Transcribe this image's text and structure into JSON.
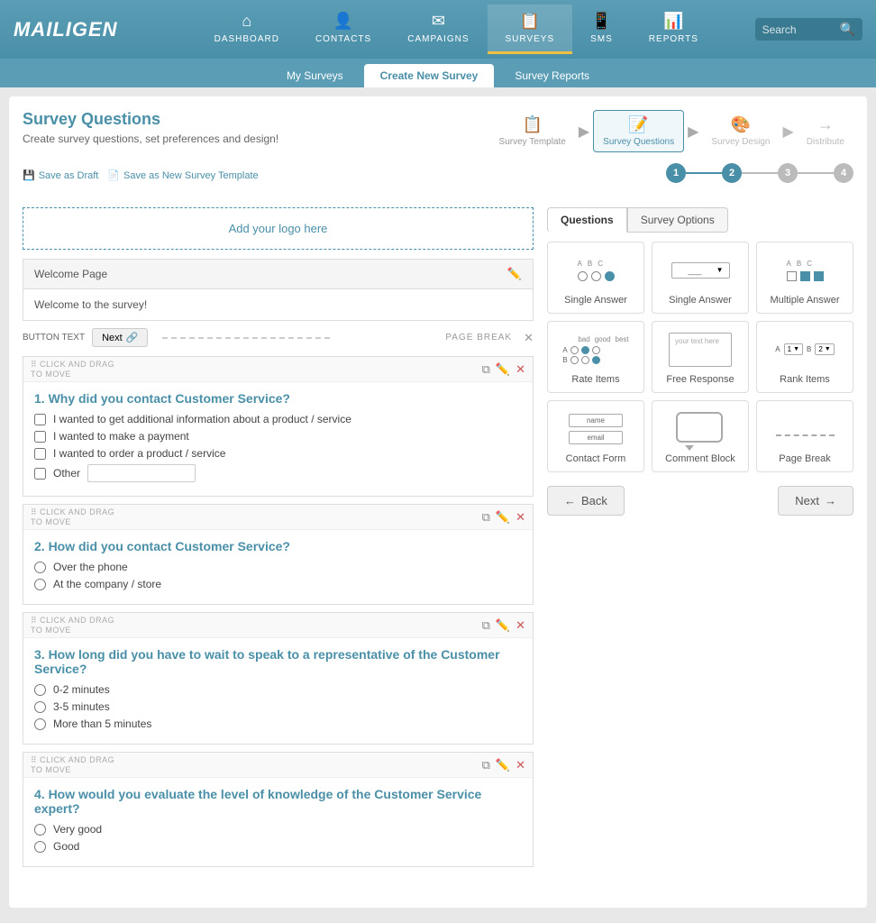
{
  "brand": "MAILIGEN",
  "nav": {
    "items": [
      {
        "label": "DASHBOARD",
        "icon": "⌂",
        "active": false
      },
      {
        "label": "CONTACTS",
        "icon": "👤",
        "active": false
      },
      {
        "label": "CAMPAIGNS",
        "icon": "✉",
        "active": false
      },
      {
        "label": "SURVEYS",
        "icon": "📋",
        "active": true
      },
      {
        "label": "SMS",
        "icon": "📱",
        "active": false
      },
      {
        "label": "REPORTS",
        "icon": "📊",
        "active": false
      }
    ],
    "search_placeholder": "Search"
  },
  "subnav": {
    "items": [
      {
        "label": "My Surveys",
        "active": false
      },
      {
        "label": "Create New Survey",
        "active": true
      },
      {
        "label": "Survey Reports",
        "active": false
      }
    ]
  },
  "page": {
    "title": "Survey Questions",
    "subtitle": "Create survey questions, set preferences and design!",
    "save_draft": "Save as Draft",
    "save_template": "Save as New Survey Template"
  },
  "workflow": {
    "steps": [
      {
        "label": "Survey Template",
        "icon": "📋",
        "active": false,
        "num": 1
      },
      {
        "label": "Survey Questions",
        "icon": "📝",
        "active": true,
        "num": 2
      },
      {
        "label": "Survey Design",
        "icon": "🎨",
        "active": false,
        "num": 3
      },
      {
        "label": "Distribute",
        "icon": "→",
        "active": false,
        "num": 4
      }
    ]
  },
  "logo_area": {
    "text": "Add your logo here"
  },
  "welcome_page": {
    "label": "Welcome Page",
    "content": "Welcome to the survey!",
    "button_text": "Next",
    "page_break": "PAGE BREAK"
  },
  "questions": [
    {
      "number": 1,
      "text": "Why did you contact Customer Service?",
      "type": "multiple_choice",
      "options": [
        "I wanted to get additional information about a product / service",
        "I wanted to make a payment",
        "I wanted to order a product / service",
        "Other"
      ],
      "has_other": true
    },
    {
      "number": 2,
      "text": "How did you contact Customer Service?",
      "type": "radio",
      "options": [
        "Over the phone",
        "At the company / store"
      ]
    },
    {
      "number": 3,
      "text": "How long did you have to wait to speak to a representative of the Customer Service?",
      "type": "radio",
      "options": [
        "0-2 minutes",
        "3-5 minutes",
        "More than 5 minutes"
      ]
    },
    {
      "number": 4,
      "text": "How would you evaluate the level of knowledge of the Customer Service expert?",
      "type": "radio",
      "options": [
        "Very good",
        "Good"
      ]
    }
  ],
  "panel": {
    "tabs": [
      {
        "label": "Questions",
        "active": true
      },
      {
        "label": "Survey Options",
        "active": false
      }
    ],
    "question_types": [
      {
        "label": "Single Answer",
        "type": "single_answer_radio"
      },
      {
        "label": "Single Answer",
        "type": "single_answer_dropdown"
      },
      {
        "label": "Multiple Answer",
        "type": "multiple_answer"
      },
      {
        "label": "Rate Items",
        "type": "rate_items"
      },
      {
        "label": "Free Response",
        "type": "free_response"
      },
      {
        "label": "Rank Items",
        "type": "rank_items"
      },
      {
        "label": "Contact Form",
        "type": "contact_form"
      },
      {
        "label": "Comment Block",
        "type": "comment_block"
      },
      {
        "label": "Page Break",
        "type": "page_break"
      }
    ]
  },
  "buttons": {
    "back": "Back",
    "next": "Next"
  }
}
